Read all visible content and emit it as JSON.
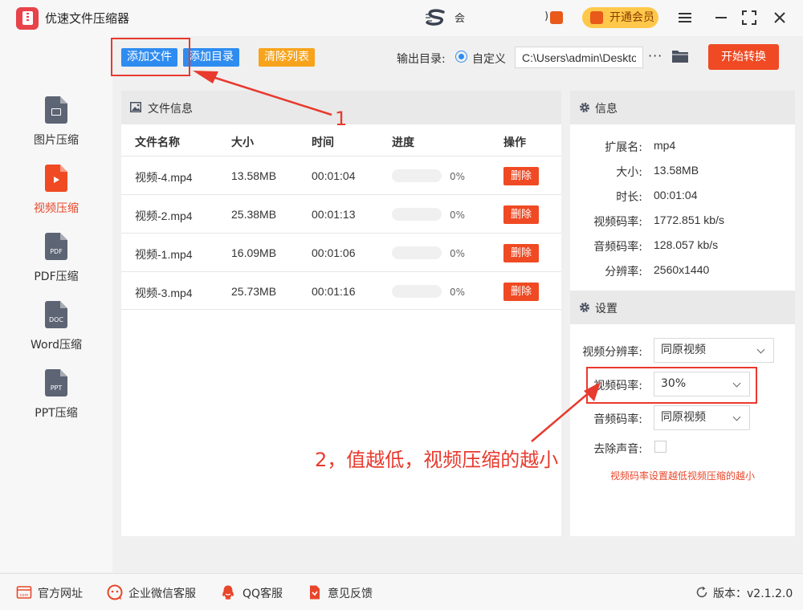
{
  "app": {
    "title": "优速文件压缩器"
  },
  "titlebar": {
    "banner_text": "会",
    "banner_tail": ")",
    "vip_label": "开通会员"
  },
  "sidebar": {
    "items": [
      {
        "label": "图片压缩",
        "icon": "image-file-icon",
        "active": false
      },
      {
        "label": "视频压缩",
        "icon": "video-file-icon",
        "active": true
      },
      {
        "label": "PDF压缩",
        "icon": "pdf-file-icon",
        "icon_text": "PDF",
        "active": false
      },
      {
        "label": "Word压缩",
        "icon": "doc-file-icon",
        "icon_text": "DOC",
        "active": false
      },
      {
        "label": "PPT压缩",
        "icon": "ppt-file-icon",
        "icon_text": "PPT",
        "active": false
      }
    ]
  },
  "toolbar": {
    "add_file": "添加文件",
    "add_dir": "添加目录",
    "clear_list": "清除列表",
    "output_label": "输出目录:",
    "custom_label": "自定义",
    "output_path": "C:\\Users\\admin\\Deskto",
    "more": "···",
    "start": "开始转换"
  },
  "file_panel": {
    "title": "文件信息",
    "columns": [
      "文件名称",
      "大小",
      "时间",
      "进度",
      "操作"
    ],
    "rows": [
      {
        "name": "视频-4.mp4",
        "size": "13.58MB",
        "time": "00:01:04",
        "progress": 0,
        "progress_text": "0%",
        "action": "删除"
      },
      {
        "name": "视频-2.mp4",
        "size": "25.38MB",
        "time": "00:01:13",
        "progress": 0,
        "progress_text": "0%",
        "action": "删除"
      },
      {
        "name": "视频-1.mp4",
        "size": "16.09MB",
        "time": "00:01:06",
        "progress": 0,
        "progress_text": "0%",
        "action": "删除"
      },
      {
        "name": "视频-3.mp4",
        "size": "25.73MB",
        "time": "00:01:16",
        "progress": 0,
        "progress_text": "0%",
        "action": "删除"
      }
    ]
  },
  "info": {
    "title": "信息",
    "fields": [
      {
        "key": "扩展名:",
        "value": "mp4"
      },
      {
        "key": "大小:",
        "value": "13.58MB"
      },
      {
        "key": "时长:",
        "value": "00:01:04"
      },
      {
        "key": "视频码率:",
        "value": "1772.851 kb/s"
      },
      {
        "key": "音频码率:",
        "value": "128.057 kb/s"
      },
      {
        "key": "分辨率:",
        "value": "2560x1440"
      }
    ]
  },
  "settings": {
    "title": "设置",
    "video_resolution_label": "视频分辨率:",
    "video_resolution_value": "同原视频",
    "video_bitrate_label": "视频码率:",
    "video_bitrate_value": "30%",
    "audio_bitrate_label": "音频码率:",
    "audio_bitrate_value": "同原视频",
    "remove_audio_label": "去除声音:",
    "remove_audio_checked": false,
    "hint": "视频码率设置越低视频压缩的越小"
  },
  "annotations": {
    "step1": "1",
    "step2": "2，值越低，视频压缩的越小",
    "color": "#e83a2e"
  },
  "footer": {
    "links": [
      {
        "label": "官方网址",
        "icon": "website-icon"
      },
      {
        "label": "企业微信客服",
        "icon": "wechat-service-icon"
      },
      {
        "label": "QQ客服",
        "icon": "qq-icon"
      },
      {
        "label": "意见反馈",
        "icon": "feedback-icon"
      }
    ],
    "version_label": "版本：v2.1.2.0"
  },
  "colors": {
    "accent_red": "#ef4a23",
    "accent_blue": "#2e8cf0",
    "accent_orange": "#f7a41c",
    "vip_yellow": "#ffc84a"
  }
}
